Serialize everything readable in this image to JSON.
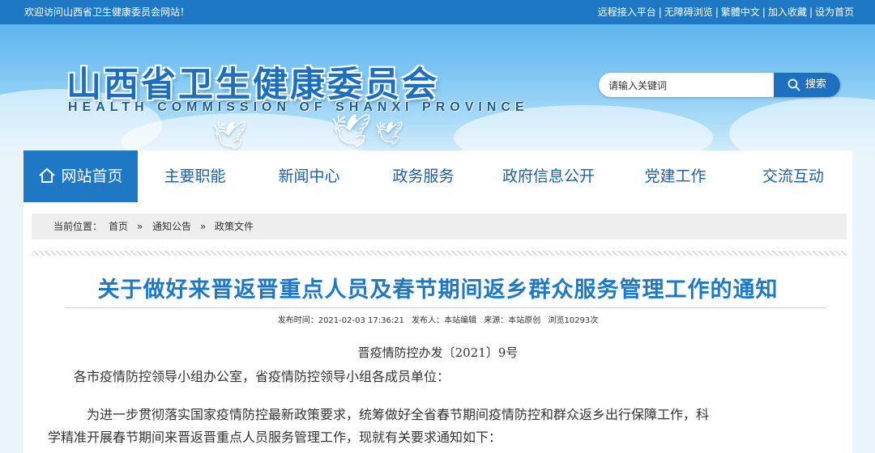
{
  "topbar": {
    "welcome": "欢迎访问山西省卫生健康委员会网站！",
    "links": [
      "远程接入平台",
      "无障碍浏览",
      "繁體中文",
      "加入收藏",
      "设为首页"
    ],
    "separator": "|"
  },
  "header": {
    "title": "山西省卫生健康委员会",
    "subtitle": "HEALTH COMMISSION OF SHANXI PROVINCE"
  },
  "search": {
    "placeholder": "请输入关键词",
    "button_label": "搜索",
    "button_icon": "search-icon"
  },
  "nav": {
    "home_icon": "home-icon",
    "items": [
      "网站首页",
      "主要职能",
      "新闻中心",
      "政务服务",
      "政府信息公开",
      "党建工作",
      "交流互动"
    ],
    "active_index": 0
  },
  "breadcrumb": {
    "prefix": "当前位置：",
    "items": [
      "首页",
      "通知公告",
      "政策文件"
    ],
    "separator": "»"
  },
  "article": {
    "title": "关于做好来晋返晋重点人员及春节期间返乡群众服务管理工作的通知",
    "meta": {
      "publish_time": "发布时间：2021-02-03 17:36:21",
      "publisher": "发布人：本站编辑",
      "source": "来源：本站原创",
      "views": "浏览10293次"
    },
    "doc_number": "晋疫情防控办发〔2021〕9号",
    "salutation": "各市疫情防控领导小组办公室，省疫情防控领导小组各成员单位：",
    "body_line1": "为进一步贯彻落实国家疫情防控最新政策要求，统筹做好全省春节期间疫情防控和群众返乡出行保障工作，科",
    "body_line2": "学精准开展春节期间来晋返晋重点人员服务管理工作，现就有关要求通知如下："
  },
  "colors": {
    "primary": "#1f78c4",
    "nav_text": "#1f5f9f",
    "title_blue": "#1f78c4"
  }
}
